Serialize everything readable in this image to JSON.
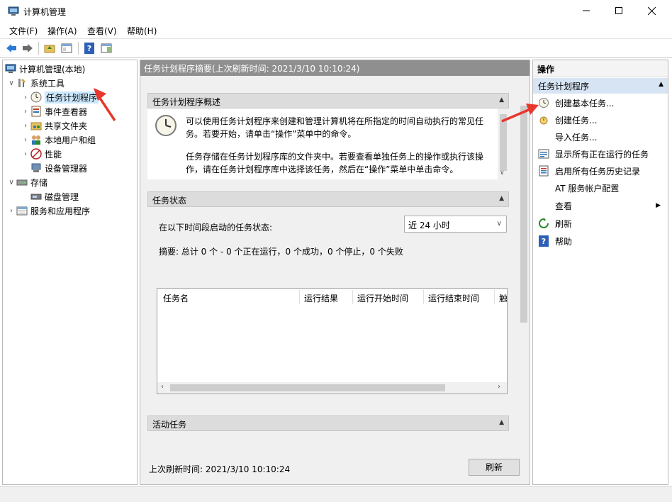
{
  "window": {
    "title": "计算机管理",
    "minimize_glyph": "—",
    "close_glyph": "✕"
  },
  "menu": [
    {
      "label": "文件(F)"
    },
    {
      "label": "操作(A)"
    },
    {
      "label": "查看(V)"
    },
    {
      "label": "帮助(H)"
    }
  ],
  "tree": {
    "root": "计算机管理(本地)",
    "items": [
      {
        "label": "系统工具"
      },
      {
        "label": "任务计划程序"
      },
      {
        "label": "事件查看器"
      },
      {
        "label": "共享文件夹"
      },
      {
        "label": "本地用户和组"
      },
      {
        "label": "性能"
      },
      {
        "label": "设备管理器"
      },
      {
        "label": "存储"
      },
      {
        "label": "磁盘管理"
      },
      {
        "label": "服务和应用程序"
      }
    ]
  },
  "center": {
    "header": "任务计划程序摘要(上次刷新时间: 2021/3/10 10:10:24)",
    "overview": {
      "title": "任务计划程序概述",
      "para1": "可以使用任务计划程序来创建和管理计算机将在所指定的时间自动执行的常见任务。若要开始，请单击“操作”菜单中的命令。",
      "para2": "任务存储在任务计划程序库的文件夹中。若要查看单独任务上的操作或执行该操作，请在任务计划程序库中选择该任务，然后在“操作”菜单中单击命令。"
    },
    "status": {
      "title": "任务状态",
      "period_label": "在以下时间段启动的任务状态:",
      "period_value": "近 24 小时",
      "summary": "摘要: 总计 0 个 - 0 个正在运行，0 个成功，0 个停止，0 个失败",
      "columns": [
        "任务名",
        "运行结果",
        "运行开始时间",
        "运行结束时间",
        "触"
      ]
    },
    "active": {
      "title": "活动任务"
    },
    "last_refresh": "上次刷新时间: 2021/3/10 10:10:24",
    "refresh_button": "刷新"
  },
  "actions": {
    "header": "操作",
    "section": "任务计划程序",
    "items": [
      {
        "label": "创建基本任务..."
      },
      {
        "label": "创建任务..."
      },
      {
        "label": "导入任务..."
      },
      {
        "label": "显示所有正在运行的任务"
      },
      {
        "label": "启用所有任务历史记录"
      },
      {
        "label": "AT 服务帐户配置"
      },
      {
        "label": "查看"
      },
      {
        "label": "刷新"
      },
      {
        "label": "帮助"
      }
    ]
  },
  "colors": {
    "selection": "#cce8ff",
    "center_header": "#8f8f8f",
    "actions_section": "#d6e4f3",
    "annotation_arrow": "#e8372c"
  }
}
